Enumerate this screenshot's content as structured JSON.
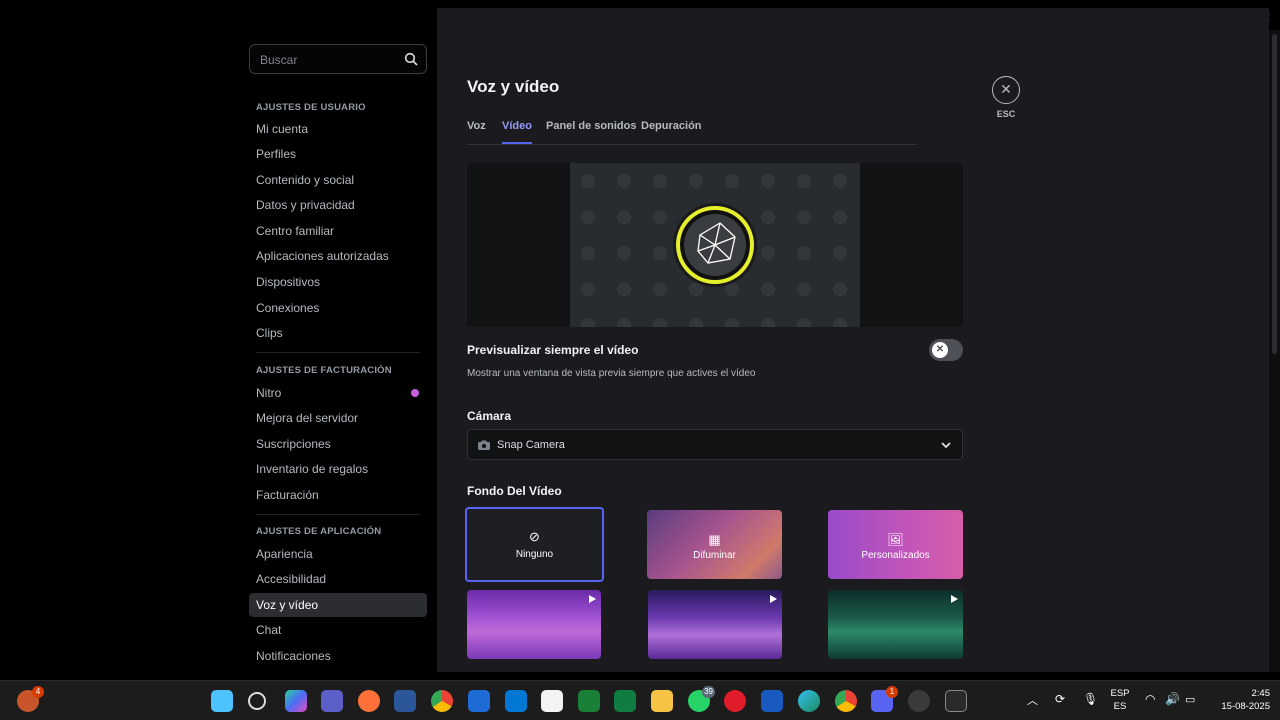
{
  "window": {
    "minimize": "–",
    "maximize": "☐",
    "close": "✕"
  },
  "search": {
    "placeholder": "Buscar"
  },
  "sections": {
    "user": "AJUSTES DE USUARIO",
    "billing": "AJUSTES DE FACTURACIÓN",
    "app": "AJUSTES DE APLICACIÓN"
  },
  "nav_user": [
    "Mi cuenta",
    "Perfiles",
    "Contenido y social",
    "Datos y privacidad",
    "Centro familiar",
    "Aplicaciones autorizadas",
    "Dispositivos",
    "Conexiones",
    "Clips"
  ],
  "nav_billing": [
    "Nitro",
    "Mejora del servidor",
    "Suscripciones",
    "Inventario de regalos",
    "Facturación"
  ],
  "nav_app": [
    "Apariencia",
    "Accesibilidad",
    "Voz y vídeo",
    "Chat",
    "Notificaciones"
  ],
  "page": {
    "title": "Voz y vídeo",
    "tabs": [
      "Voz",
      "Vídeo",
      "Panel de sonidos",
      "Depuración"
    ],
    "active_tab": "Vídeo"
  },
  "preview": {
    "option_title": "Previsualizar siempre el vídeo",
    "option_desc": "Mostrar una ventana de vista previa siempre que actives el vídeo",
    "toggle_on": false,
    "toggle_glyph": "✕"
  },
  "camera": {
    "label": "Cámara",
    "value": "Snap Camera"
  },
  "background": {
    "label": "Fondo Del Vídeo",
    "options": [
      "Ninguno",
      "Difuminar",
      "Personalizados"
    ]
  },
  "esc": {
    "label": "ESC",
    "glyph": "✕"
  },
  "taskbar": {
    "badge_left": "4",
    "badge_whatsapp": "39",
    "badge_discord": "1",
    "lang_top": "ESP",
    "lang_bottom": "ES",
    "time": "2:45",
    "date": "15-08-2025"
  },
  "colors": {
    "accent": "#5865f2",
    "tab_active": "#949cf7",
    "nitro": "#c95ee0",
    "selected_tile_border": "#5865f2"
  }
}
